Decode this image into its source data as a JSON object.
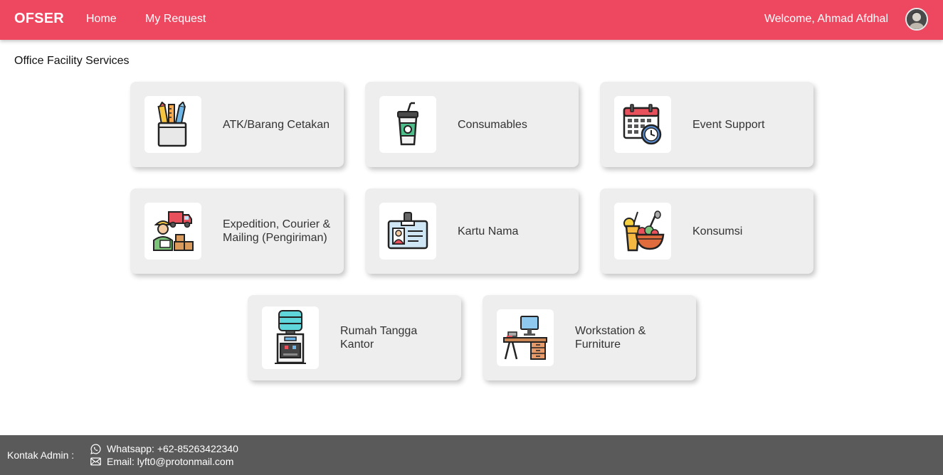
{
  "navbar": {
    "brand": "OFSER",
    "home_label": "Home",
    "request_label": "My Request",
    "welcome_text": "Welcome, Ahmad Afdhal",
    "accent_color": "#ee4760"
  },
  "main": {
    "title": "Office Facility Services",
    "services": [
      {
        "label": "ATK/Barang Cetakan",
        "icon": "stationery-icon"
      },
      {
        "label": "Consumables",
        "icon": "drink-cup-icon"
      },
      {
        "label": "Event Support",
        "icon": "calendar-clock-icon"
      },
      {
        "label": "Expedition, Courier & Mailing (Pengiriman)",
        "icon": "courier-icon"
      },
      {
        "label": "Kartu Nama",
        "icon": "id-card-icon"
      },
      {
        "label": "Konsumsi",
        "icon": "food-drink-icon"
      },
      {
        "label": "Rumah Tangga Kantor",
        "icon": "water-dispenser-icon"
      },
      {
        "label": "Workstation & Furniture",
        "icon": "workstation-desk-icon"
      }
    ]
  },
  "footer": {
    "kontak_label": "Kontak Admin :",
    "whatsapp": "Whatsapp: +62-85263422340",
    "email": "Email: lyft0@protonmail.com",
    "background_color": "#5a5a5a"
  }
}
